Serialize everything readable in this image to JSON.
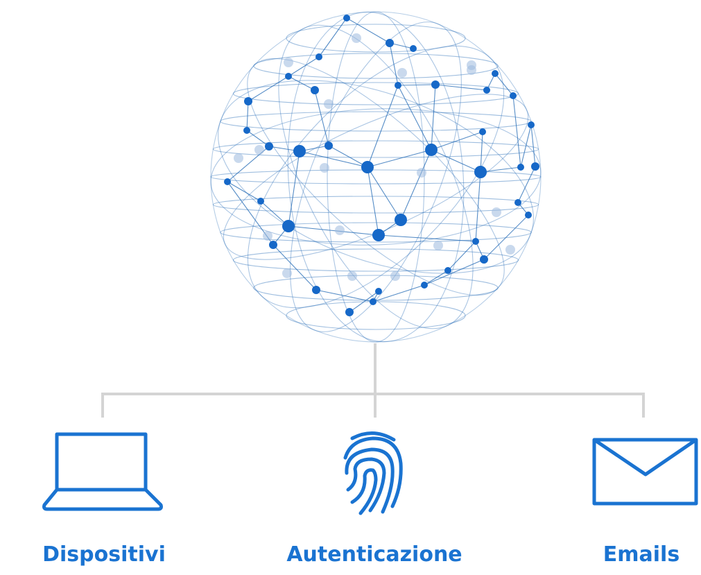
{
  "colors": {
    "accent": "#1a73d1",
    "connector": "#d4d4d4",
    "globe_line": "#2a6fb8",
    "globe_node": "#1668c8"
  },
  "globe": {
    "icon": "network-globe-icon"
  },
  "branches": [
    {
      "label": "Dispositivi",
      "icon": "laptop-icon"
    },
    {
      "label": "Autenticazione",
      "icon": "fingerprint-icon"
    },
    {
      "label": "Emails",
      "icon": "envelope-icon"
    }
  ]
}
